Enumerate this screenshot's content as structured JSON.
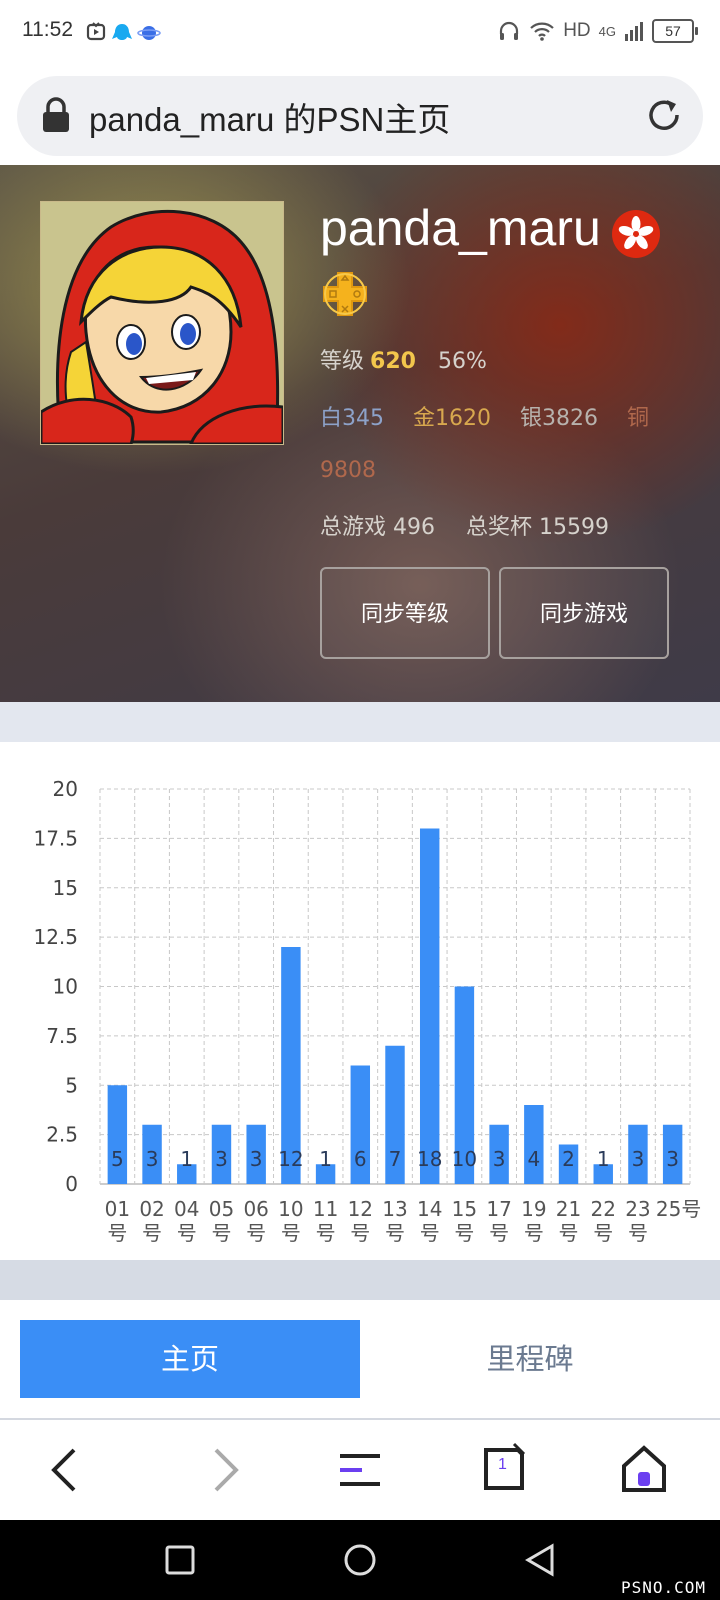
{
  "status_bar": {
    "time": "11:52",
    "network": "HD",
    "signal": "4G",
    "battery": "57"
  },
  "url_bar": {
    "title": "panda_maru 的PSN主页"
  },
  "profile": {
    "username": "panda_maru",
    "level_label": "等级",
    "level_value": "620",
    "level_percent": "56%",
    "trophies": {
      "platinum": "白345",
      "gold": "金1620",
      "silver": "银3826",
      "bronze": "铜9808"
    },
    "total_games": "总游戏 496",
    "total_trophies": "总奖杯 15599",
    "sync_level_label": "同步等级",
    "sync_games_label": "同步游戏"
  },
  "chart_data": {
    "type": "bar",
    "categories": [
      "01号",
      "02号",
      "04号",
      "05号",
      "06号",
      "10号",
      "11号",
      "12号",
      "13号",
      "14号",
      "15号",
      "17号",
      "19号",
      "21号",
      "22号",
      "23号",
      "25号"
    ],
    "values": [
      5,
      3,
      1,
      3,
      3,
      12,
      1,
      6,
      7,
      18,
      10,
      3,
      4,
      2,
      1,
      3,
      3
    ],
    "ylim": [
      0,
      20
    ],
    "yticks": [
      "0",
      "2.5",
      "5",
      "7.5",
      "10",
      "12.5",
      "15",
      "17.5",
      "20"
    ],
    "grid": true,
    "bar_color": "#3a8ef6"
  },
  "tabs": {
    "home": "主页",
    "milestone": "里程碑"
  },
  "browser_nav": {
    "tab_count": "1"
  },
  "watermark": "PSNO.COM"
}
